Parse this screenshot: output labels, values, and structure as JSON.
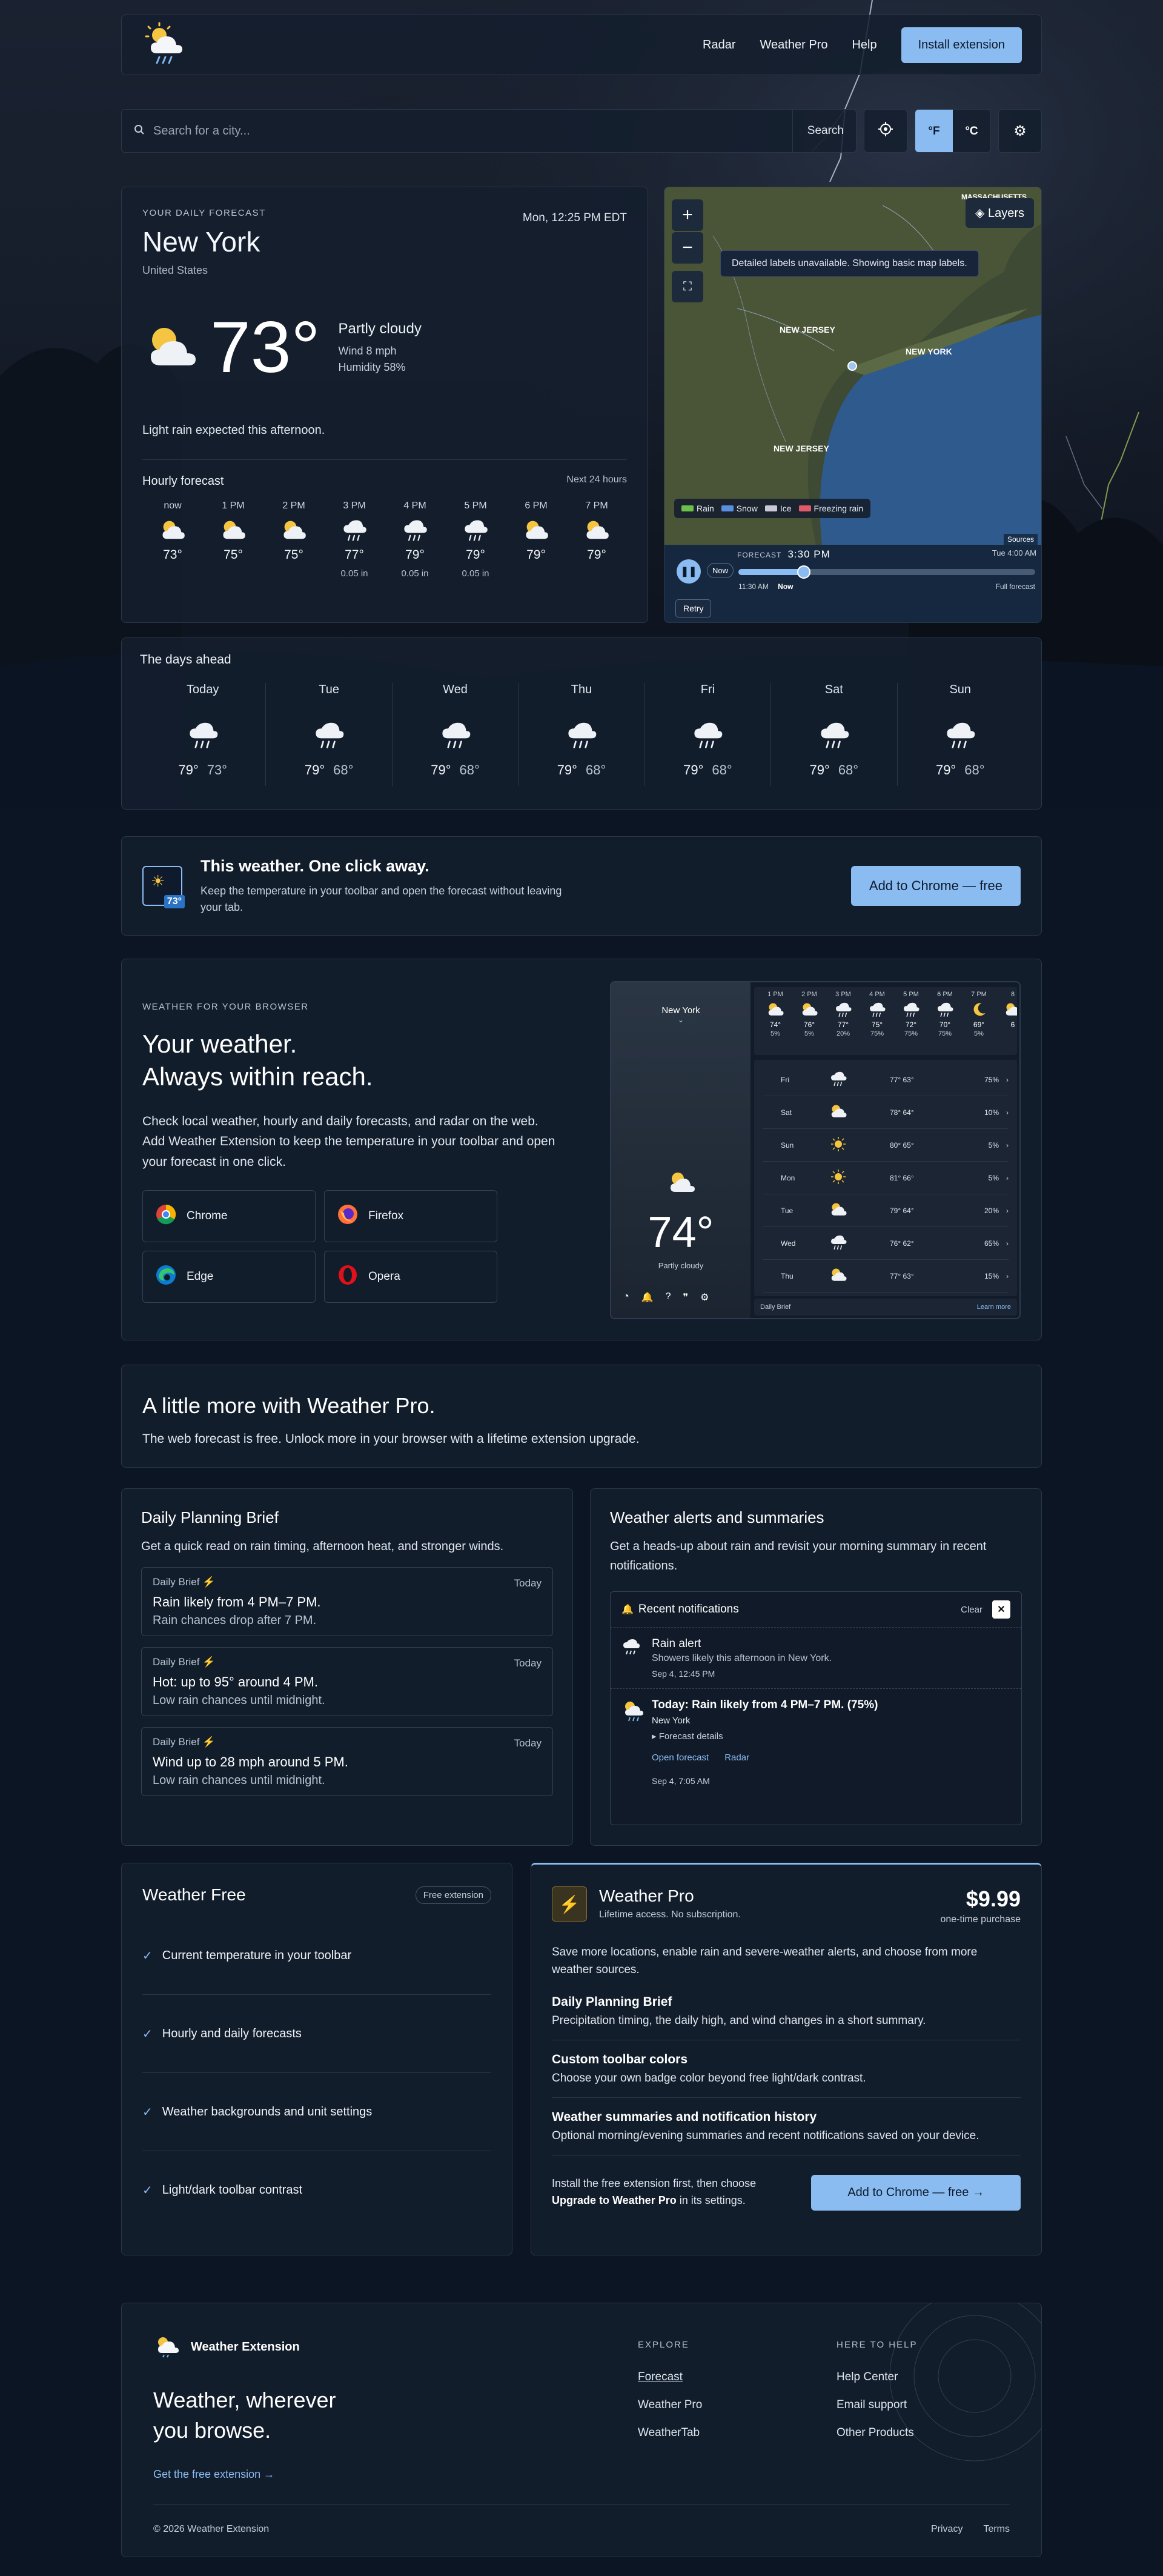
{
  "header": {
    "nav": [
      "Radar",
      "Weather Pro",
      "Help"
    ],
    "install_label": "Install extension"
  },
  "search": {
    "placeholder": "Search for a city...",
    "button_label": "Search",
    "unit_f": "°F",
    "unit_c": "°C"
  },
  "forecast": {
    "eyebrow": "YOUR DAILY FORECAST",
    "city": "New York",
    "country": "United States",
    "datetime": "Mon, 12:25 PM EDT",
    "temp": "73°",
    "condition": "Partly cloudy",
    "wind": "Wind 8 mph",
    "humidity": "Humidity 58%",
    "note": "Light rain expected this afternoon.",
    "hourly_title": "Hourly forecast",
    "hourly_range": "Next 24 hours",
    "hours": [
      {
        "time": "now",
        "temp": "73°",
        "precip": "",
        "icon": "partly-cloudy"
      },
      {
        "time": "1 PM",
        "temp": "75°",
        "precip": "",
        "icon": "partly-cloudy"
      },
      {
        "time": "2 PM",
        "temp": "75°",
        "precip": "",
        "icon": "partly-cloudy"
      },
      {
        "time": "3 PM",
        "temp": "77°",
        "precip": "0.05 in",
        "icon": "rain"
      },
      {
        "time": "4 PM",
        "temp": "79°",
        "precip": "0.05 in",
        "icon": "rain"
      },
      {
        "time": "5 PM",
        "temp": "79°",
        "precip": "0.05 in",
        "icon": "rain"
      },
      {
        "time": "6 PM",
        "temp": "79°",
        "precip": "",
        "icon": "partly-cloudy"
      },
      {
        "time": "7 PM",
        "temp": "79°",
        "precip": "",
        "icon": "partly-cloudy"
      }
    ]
  },
  "map": {
    "layers_label": "Layers",
    "notice": "Detailed labels unavailable. Showing basic map labels.",
    "labels": [
      "NEW JERSEY",
      "NEW YORK",
      "NEW JERSEY",
      "MASSACHUSETTS"
    ],
    "legend": [
      "Rain",
      "Snow",
      "Ice",
      "Freezing rain"
    ],
    "legend_colors": [
      "#6cc04a",
      "#5a8fe0",
      "#c8c8d8",
      "#e05a6a"
    ],
    "sources": "Sources",
    "forecast_label": "FORECAST",
    "forecast_time": "3:30 PM",
    "end_time": "Tue 4:00 AM",
    "start_time": "11:30 AM",
    "now_label": "Now",
    "full_label": "Full forecast",
    "now_button": "Now",
    "retry": "Retry",
    "timeline_position": 0.22
  },
  "days": {
    "title": "The days ahead",
    "items": [
      {
        "day": "Today",
        "hi": "79°",
        "lo": "73°"
      },
      {
        "day": "Tue",
        "hi": "79°",
        "lo": "68°"
      },
      {
        "day": "Wed",
        "hi": "79°",
        "lo": "68°"
      },
      {
        "day": "Thu",
        "hi": "79°",
        "lo": "68°"
      },
      {
        "day": "Fri",
        "hi": "79°",
        "lo": "68°"
      },
      {
        "day": "Sat",
        "hi": "79°",
        "lo": "68°"
      },
      {
        "day": "Sun",
        "hi": "79°",
        "lo": "68°"
      }
    ]
  },
  "promo": {
    "badge": "73°",
    "title": "This weather. One click away.",
    "subtitle": "Keep the temperature in your toolbar and open the forecast without leaving your tab.",
    "button": "Add to Chrome — free"
  },
  "browser": {
    "eyebrow": "WEATHER FOR YOUR BROWSER",
    "title_1": "Your weather.",
    "title_2": "Always within reach.",
    "body": "Check local weather, hourly and daily forecasts, and radar on the web. Add Weather Extension to keep the temperature in your toolbar and open your forecast in one click.",
    "browsers": [
      "Chrome",
      "Firefox",
      "Edge",
      "Opera"
    ],
    "preview": {
      "city": "New York",
      "temp": "74°",
      "condition": "Partly cloudy",
      "hours": [
        {
          "t": "1 PM",
          "v": "74°",
          "p": "5%"
        },
        {
          "t": "2 PM",
          "v": "76°",
          "p": "5%"
        },
        {
          "t": "3 PM",
          "v": "77°",
          "p": "20%"
        },
        {
          "t": "4 PM",
          "v": "75°",
          "p": "75%"
        },
        {
          "t": "5 PM",
          "v": "72°",
          "p": "75%"
        },
        {
          "t": "6 PM",
          "v": "70°",
          "p": "75%"
        },
        {
          "t": "7 PM",
          "v": "69°",
          "p": "5%"
        },
        {
          "t": "8",
          "v": "6",
          "p": ""
        }
      ],
      "days": [
        {
          "d": "Fri",
          "t": "77° 63°",
          "p": "75%"
        },
        {
          "d": "Sat",
          "t": "78° 64°",
          "p": "10%"
        },
        {
          "d": "Sun",
          "t": "80° 65°",
          "p": "5%"
        },
        {
          "d": "Mon",
          "t": "81° 66°",
          "p": "5%"
        },
        {
          "d": "Tue",
          "t": "79° 64°",
          "p": "20%"
        },
        {
          "d": "Wed",
          "t": "76° 62°",
          "p": "65%"
        },
        {
          "d": "Thu",
          "t": "77° 63°",
          "p": "15%"
        }
      ],
      "footer_left": "Daily Brief",
      "footer_right": "Learn more"
    }
  },
  "more": {
    "title": "A little more with Weather Pro.",
    "body": "The web forecast is free. Unlock more in your browser with a lifetime extension upgrade."
  },
  "planning": {
    "title": "Daily Planning Brief",
    "desc": "Get a quick read on rain timing, afternoon heat, and stronger winds.",
    "briefs": [
      {
        "tag": "Daily Brief",
        "date": "Today",
        "head": "Rain likely from 4 PM–7 PM.",
        "sub": "Rain chances drop after 7 PM."
      },
      {
        "tag": "Daily Brief",
        "date": "Today",
        "head": "Hot: up to 95° around 4 PM.",
        "sub": "Low rain chances until midnight."
      },
      {
        "tag": "Daily Brief",
        "date": "Today",
        "head": "Wind up to 28 mph around 5 PM.",
        "sub": "Low rain chances until midnight."
      }
    ]
  },
  "alerts": {
    "title": "Weather alerts and summaries",
    "desc": "Get a heads-up about rain and revisit your morning summary in recent notifications.",
    "panel_title": "Recent notifications",
    "clear": "Clear",
    "n1_title": "Rain alert",
    "n1_body": "Showers likely this afternoon in New York.",
    "n1_date": "Sep 4, 12:45 PM",
    "n2_title": "Today: Rain likely from 4 PM–7 PM. (75%)",
    "n2_city": "New York",
    "n2_details": "▸ Forecast details",
    "n2_link1": "Open forecast",
    "n2_link2": "Radar",
    "n2_date": "Sep 4, 7:05 AM"
  },
  "free": {
    "title": "Weather Free",
    "badge": "Free extension",
    "features": [
      "Current temperature in your toolbar",
      "Hourly and daily forecasts",
      "Weather backgrounds and unit settings",
      "Light/dark toolbar contrast"
    ]
  },
  "pro": {
    "title": "Weather Pro",
    "subtitle": "Lifetime access. No subscription.",
    "price": "$9.99",
    "price_note": "one-time purchase",
    "intro": "Save more locations, enable rain and severe-weather alerts, and choose from more weather sources.",
    "rows": [
      {
        "h": "Daily Planning Brief",
        "p": "Precipitation timing, the daily high, and wind changes in a short summary."
      },
      {
        "h": "Custom toolbar colors",
        "p": "Choose your own badge color beyond free light/dark contrast."
      },
      {
        "h": "Weather summaries and notification history",
        "p": "Optional morning/evening summaries and recent notifications saved on your device."
      }
    ],
    "install_note_1": "Install the free extension first, then choose",
    "install_note_bold": "Upgrade to Weather Pro",
    "install_note_2": "in its settings.",
    "button": "Add to Chrome — free →"
  },
  "footer": {
    "brand": "Weather Extension",
    "tagline": "Weather, wherever you browse.",
    "cta": "Get the free extension →",
    "explore_title": "EXPLORE",
    "explore": [
      "Forecast",
      "Weather Pro",
      "WeatherTab"
    ],
    "help_title": "HERE TO HELP",
    "help": [
      "Help Center",
      "Email support",
      "Other Products"
    ],
    "copyright": "© 2026 Weather Extension",
    "legal": [
      "Privacy",
      "Terms"
    ]
  }
}
